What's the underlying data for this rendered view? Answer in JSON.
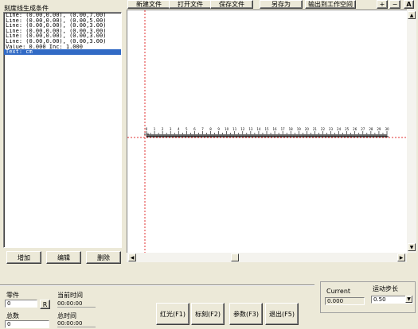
{
  "left_panel": {
    "title": "刻度线生成条件",
    "items": [
      "Line: (0.00,0.00), (0.00,7.00)",
      "Line: (0.00,0.00), (0.00,5.00)",
      "Line: (0.00,0.00), (0.00,3.00)",
      "Line: (0.00,0.00), (0.00,3.00)",
      "Line: (0.00,0.00), (0.00,3.00)",
      "Line: (0.00,0.00), (0.00,3.00)",
      "Value: 0.000 Inc: 1.000",
      "Text: cm"
    ],
    "selected_index": 7,
    "buttons": {
      "add": "增加",
      "edit": "编辑",
      "delete": "删除"
    }
  },
  "toolbar": {
    "new_file": "新建文件",
    "open_file": "打开文件",
    "save_file": "保存文件",
    "save_as": "另存为",
    "export_workspace": "输出到工作空间",
    "zoom_in": "+",
    "zoom_out": "−",
    "fit": "A"
  },
  "ruler": {
    "start": 0,
    "end": 30,
    "step": 1,
    "unit_label": "cm"
  },
  "bottom": {
    "parts_label": "零件",
    "parts_value": "0",
    "reset_btn": "R",
    "total_label": "总数",
    "total_value": "0",
    "current_time_label": "当前时间",
    "current_time_value": "00:00:00",
    "total_time_label": "总时间",
    "total_time_value": "00:00:00",
    "red_light_btn": "红光(F1)",
    "mark_btn": "标刻(F2)",
    "params_btn": "参数(F3)",
    "exit_btn": "退出(F5)",
    "current_label": "Current",
    "current_value": "0.000",
    "step_label": "运动步长",
    "step_value": "0.50"
  },
  "colors": {
    "selection": "#316ac5",
    "guide": "#e03030",
    "workspace": "#ffffff"
  }
}
